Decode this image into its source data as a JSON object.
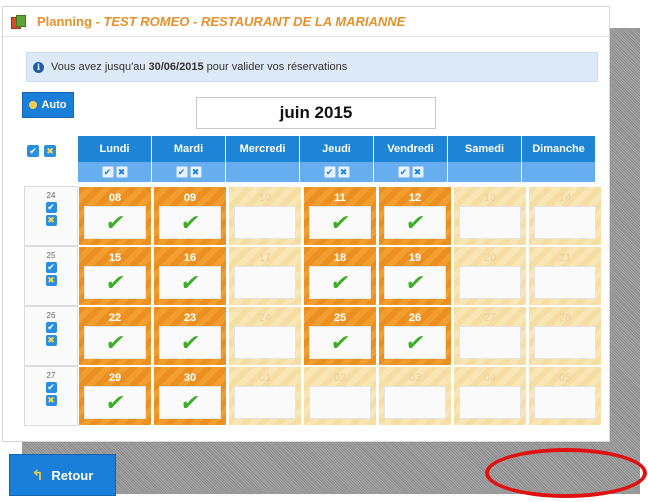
{
  "window": {
    "title_main": "Planning",
    "title_rest": " - TEST ROMEO - RESTAURANT DE LA MARIANNE"
  },
  "info": {
    "prefix": "Vous avez jusqu'au ",
    "deadline": "30/06/2015",
    "suffix": " pour valider vos réservations"
  },
  "toolbar": {
    "auto_label": "Auto"
  },
  "calendar": {
    "month_label": "juin 2015",
    "day_headers": [
      "Lundi",
      "Mardi",
      "Mercredi",
      "Jeudi",
      "Vendredi",
      "Samedi",
      "Dimanche"
    ],
    "weeks": [
      {
        "week": "24",
        "days": [
          {
            "n": "08",
            "active": true
          },
          {
            "n": "09",
            "active": true
          },
          {
            "n": "10",
            "active": false
          },
          {
            "n": "11",
            "active": true
          },
          {
            "n": "12",
            "active": true
          },
          {
            "n": "13",
            "active": false
          },
          {
            "n": "14",
            "active": false
          }
        ]
      },
      {
        "week": "25",
        "days": [
          {
            "n": "15",
            "active": true
          },
          {
            "n": "16",
            "active": true
          },
          {
            "n": "17",
            "active": false
          },
          {
            "n": "18",
            "active": true
          },
          {
            "n": "19",
            "active": true
          },
          {
            "n": "20",
            "active": false
          },
          {
            "n": "21",
            "active": false
          }
        ]
      },
      {
        "week": "26",
        "days": [
          {
            "n": "22",
            "active": true
          },
          {
            "n": "23",
            "active": true
          },
          {
            "n": "24",
            "active": false
          },
          {
            "n": "25",
            "active": true
          },
          {
            "n": "26",
            "active": true
          },
          {
            "n": "27",
            "active": false
          },
          {
            "n": "28",
            "active": false
          }
        ]
      },
      {
        "week": "27",
        "days": [
          {
            "n": "29",
            "active": true
          },
          {
            "n": "30",
            "active": true
          },
          {
            "n": "01",
            "active": false
          },
          {
            "n": "02",
            "active": false
          },
          {
            "n": "03",
            "active": false
          },
          {
            "n": "04",
            "active": false
          },
          {
            "n": "05",
            "active": false
          }
        ]
      }
    ],
    "column_toggles": [
      true,
      true,
      false,
      true,
      true,
      false,
      false
    ]
  },
  "footer": {
    "back_label": "Retour"
  },
  "colors": {
    "accent": "#1e84d6",
    "active_day": "#eb9020",
    "inactive_day": "#f6dea3",
    "check": "#3fae2a",
    "annotation": "#e01010"
  }
}
